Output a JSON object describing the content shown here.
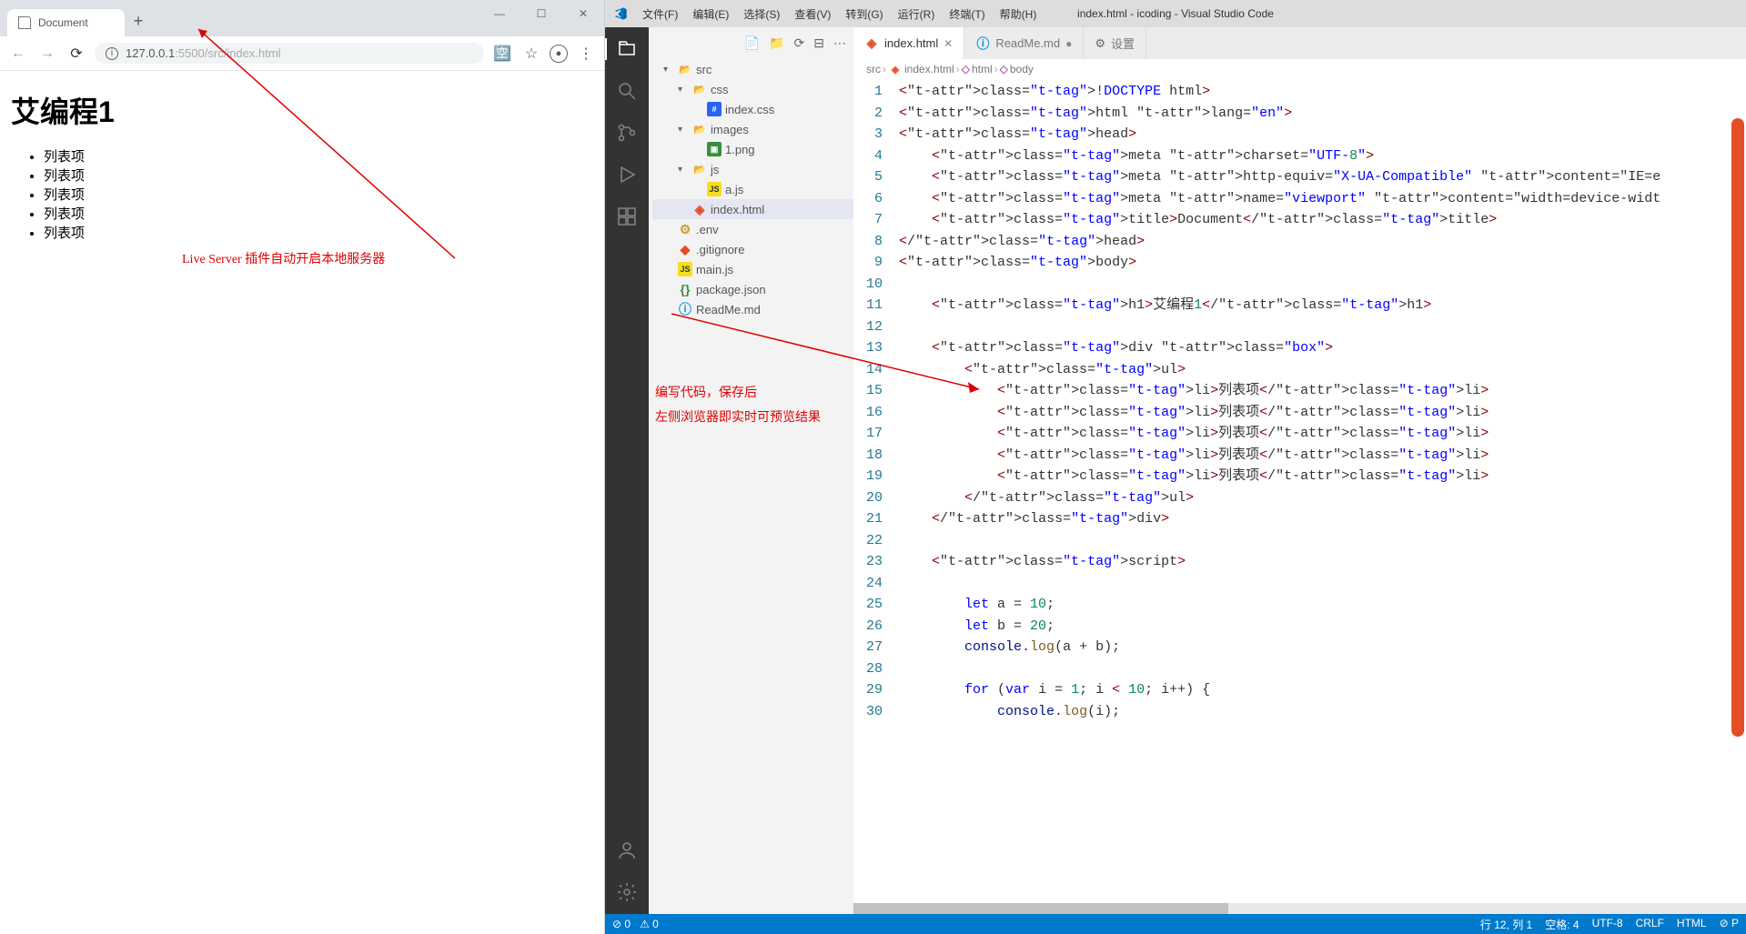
{
  "browser": {
    "tab_title": "Document",
    "url": "127.0.0.1:5500/src/index.html",
    "url_prefix": "127.0.0.1",
    "url_suffix": ":5500/src/index.html",
    "page_h1": "艾编程1",
    "list_items": [
      "列表项",
      "列表项",
      "列表项",
      "列表项",
      "列表项"
    ],
    "annotation": "Live Server 插件自动开启本地服务器"
  },
  "vscode": {
    "title": "index.html - icoding - Visual Studio Code",
    "menus": [
      "文件(F)",
      "编辑(E)",
      "选择(S)",
      "查看(V)",
      "转到(G)",
      "运行(R)",
      "终端(T)",
      "帮助(H)"
    ],
    "tree": {
      "src": "src",
      "css": "css",
      "index_css": "index.css",
      "images": "images",
      "png": "1.png",
      "js": "js",
      "ajs": "a.js",
      "index_html": "index.html",
      "env": ".env",
      "gitignore": ".gitignore",
      "mainjs": "main.js",
      "package": "package.json",
      "readme": "ReadMe.md"
    },
    "tabs": [
      {
        "label": "index.html",
        "icon": "html5",
        "active": true,
        "modified": false
      },
      {
        "label": "ReadMe.md",
        "icon": "md",
        "active": false,
        "modified": true
      },
      {
        "label": "设置",
        "icon": "gear",
        "active": false,
        "modified": false
      }
    ],
    "breadcrumb": [
      "src",
      "index.html",
      "html",
      "body"
    ],
    "code_lines": [
      "<!DOCTYPE html>",
      "<html lang=\"en\">",
      "<head>",
      "    <meta charset=\"UTF-8\">",
      "    <meta http-equiv=\"X-UA-Compatible\" content=\"IE=e",
      "    <meta name=\"viewport\" content=\"width=device-widt",
      "    <title>Document</title>",
      "</head>",
      "<body>",
      "",
      "    <h1>艾编程1</h1>",
      "",
      "    <div class=\"box\">",
      "        <ul>",
      "            <li>列表项</li>",
      "            <li>列表项</li>",
      "            <li>列表项</li>",
      "            <li>列表项</li>",
      "            <li>列表项</li>",
      "        </ul>",
      "    </div>",
      "",
      "    <script>",
      "",
      "        let a = 10;",
      "        let b = 20;",
      "        console.log(a + b);",
      "",
      "        for (var i = 1; i < 10; i++) {",
      "            console.log(i);"
    ],
    "annotation_l1": "编写代码，保存后",
    "annotation_l2": "左侧浏览器即实时可预览结果",
    "status": {
      "errors": "0",
      "warnings": "0",
      "pos": "行 12, 列 1",
      "spaces": "空格: 4",
      "enc": "UTF-8",
      "eol": "CRLF",
      "lang": "HTML",
      "port": "P"
    }
  }
}
